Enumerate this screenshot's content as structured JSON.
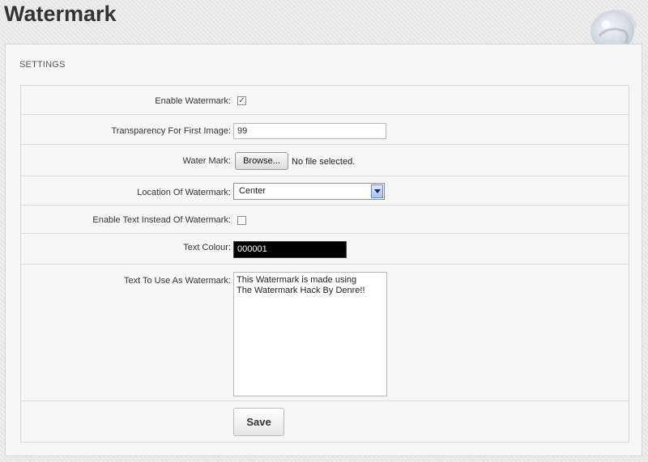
{
  "page": {
    "title": "Watermark"
  },
  "settings": {
    "heading": "SETTINGS",
    "enable_watermark": {
      "label": "Enable Watermark:",
      "checked": true
    },
    "transparency": {
      "label": "Transparency For First Image:",
      "value": "99"
    },
    "water_mark": {
      "label": "Water Mark:",
      "button": "Browse...",
      "status": "No file selected."
    },
    "location": {
      "label": "Location Of Watermark:",
      "selected": "Center"
    },
    "enable_text": {
      "label": "Enable Text Instead Of Watermark:",
      "checked": false
    },
    "text_colour": {
      "label": "Text Colour:",
      "value": "000001"
    },
    "watermark_text": {
      "label": "Text To Use As Watermark:",
      "value": "This Watermark is made using\nThe Watermark Hack By Denre!!"
    },
    "save_label": "Save"
  },
  "icons": {
    "logo": "globe-logo-icon",
    "checkmark": "checkmark-icon",
    "dropdown": "chevron-down-icon"
  },
  "colors": {
    "text_colour_swatch": "#000000",
    "panel_bg": "#f7f7f7"
  }
}
